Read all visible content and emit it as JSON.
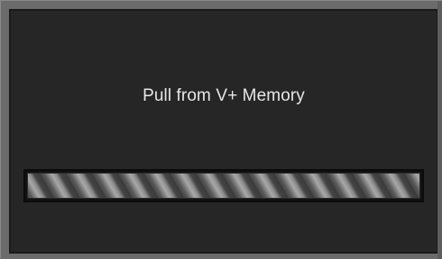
{
  "dialog": {
    "message": "Pull from V+ Memory",
    "progress": {
      "style": "indeterminate",
      "fraction": 1.0
    }
  },
  "colors": {
    "background": "#262626",
    "frame": "#6b6b6b",
    "text": "#e6e6e6",
    "stripe_light": "#a8a8a8",
    "stripe_dark": "#454545"
  }
}
